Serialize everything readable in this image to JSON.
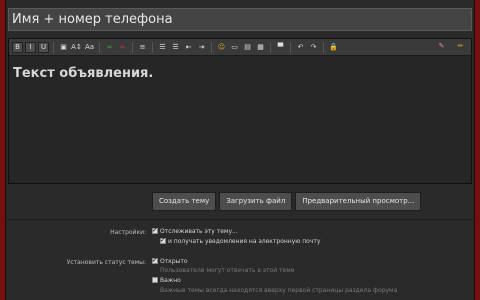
{
  "title_field": {
    "value": "Имя + номер телефона"
  },
  "editor": {
    "body_text": "Текст объявления."
  },
  "toolbar": {
    "buttons": [
      {
        "icon": "bold-icon",
        "glyph": "B"
      },
      {
        "icon": "italic-icon",
        "glyph": "I"
      },
      {
        "icon": "underline-icon",
        "glyph": "U"
      },
      {
        "icon": "text-color-icon",
        "glyph": "▣"
      },
      {
        "icon": "font-size-icon",
        "glyph": "A↕"
      },
      {
        "icon": "font-family-icon",
        "glyph": "Aa"
      },
      {
        "icon": "link-icon",
        "glyph": "∞"
      },
      {
        "icon": "unlink-icon",
        "glyph": "∞"
      },
      {
        "icon": "align-icon",
        "glyph": "≡"
      },
      {
        "icon": "bullet-list-icon",
        "glyph": "☰"
      },
      {
        "icon": "numbered-list-icon",
        "glyph": "☰"
      },
      {
        "icon": "outdent-icon",
        "glyph": "⇤"
      },
      {
        "icon": "indent-icon",
        "glyph": "⇥"
      },
      {
        "icon": "smilie-icon",
        "glyph": "☺"
      },
      {
        "icon": "image-icon",
        "glyph": "▭"
      },
      {
        "icon": "media-icon",
        "glyph": "▤"
      },
      {
        "icon": "quote-icon",
        "glyph": "▦"
      },
      {
        "icon": "save-icon",
        "glyph": "▀"
      },
      {
        "icon": "undo-icon",
        "glyph": "↶"
      },
      {
        "icon": "redo-icon",
        "glyph": "↷"
      },
      {
        "icon": "lock-icon",
        "glyph": "🔒"
      }
    ],
    "right_buttons": [
      {
        "icon": "eraser-icon",
        "glyph": "✎"
      },
      {
        "icon": "pencil-icon",
        "glyph": "✏"
      }
    ]
  },
  "actions": {
    "create_label": "Создать тему",
    "upload_label": "Загрузить файл",
    "preview_label": "Предварительный просмотр..."
  },
  "settings": {
    "label": "Настройки:",
    "watch_label": "Отслеживать эту тему...",
    "email_label": "и получать уведомления на электронную почту"
  },
  "status": {
    "label": "Установить статус темы:",
    "open_label": "Открыто",
    "open_hint": "Пользователи могут отвечать в этой теме",
    "sticky_label": "Важно",
    "sticky_hint": "Важные темы всегда находятся вверху первой страницы раздела форума"
  },
  "colors": {
    "border": "#7a0e0e",
    "panel": "#2a2a2a",
    "accent_yellow": "#e0b020"
  }
}
